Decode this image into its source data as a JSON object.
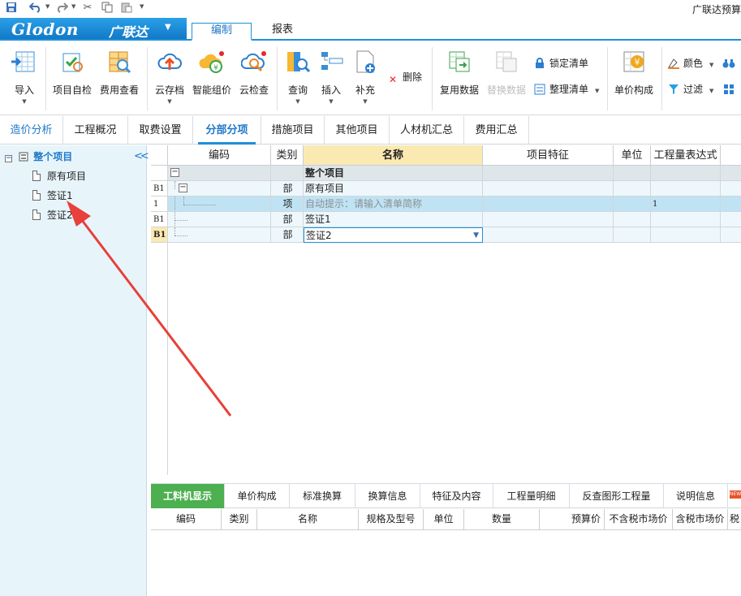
{
  "app_title": "广联达预算",
  "logo": {
    "brand": "Glodon",
    "brand_cn": "广联达"
  },
  "ribbon_tabs": [
    {
      "label": "编制",
      "active": true
    },
    {
      "label": "报表",
      "active": false
    }
  ],
  "ribbon_buttons": {
    "import": "导入",
    "self_check": "项目自检",
    "cost_view": "费用查看",
    "cloud_save": "云存档",
    "smart_price": "智能组价",
    "cloud_check": "云检查",
    "query": "查询",
    "insert": "插入",
    "supplement": "补充",
    "delete": "删除",
    "reuse_data": "复用数据",
    "replace_data": "替换数据",
    "lock_list": "锁定清单",
    "organize_list": "整理清单",
    "unit_price": "单价构成",
    "color": "颜色",
    "filter": "过滤"
  },
  "main_tabs": [
    "造价分析",
    "工程概况",
    "取费设置",
    "分部分项",
    "措施项目",
    "其他项目",
    "人材机汇总",
    "费用汇总"
  ],
  "main_tab_active": "分部分项",
  "tree": {
    "root": "整个项目",
    "children": [
      "原有项目",
      "签证1",
      "签证2"
    ]
  },
  "grid": {
    "headers": [
      "编码",
      "类别",
      "名称",
      "项目特征",
      "单位",
      "工程量表达式"
    ],
    "rows": [
      {
        "rn": "",
        "type": "",
        "name": "整个项目",
        "qty": ""
      },
      {
        "rn": "B1",
        "type": "部",
        "name": "原有项目",
        "qty": ""
      },
      {
        "rn": "1",
        "type": "项",
        "name": "自动提示：请输入清单简称",
        "qty": "1"
      },
      {
        "rn": "B1",
        "type": "部",
        "name": "签证1",
        "qty": ""
      },
      {
        "rn": "B1",
        "type": "部",
        "name": "签证2",
        "qty": ""
      }
    ]
  },
  "bottom_tabs": [
    "工料机显示",
    "单价构成",
    "标准换算",
    "换算信息",
    "特征及内容",
    "工程量明细",
    "反查图形工程量",
    "说明信息"
  ],
  "bottom_headers": [
    "编码",
    "类别",
    "名称",
    "规格及型号",
    "单位",
    "数量",
    "预算价",
    "不含税市场价",
    "含税市场价",
    "税"
  ],
  "badge_new": "NEW",
  "colors": {
    "accent": "#1e90d6",
    "active_green": "#4caf50",
    "arrow": "#e8403a"
  }
}
